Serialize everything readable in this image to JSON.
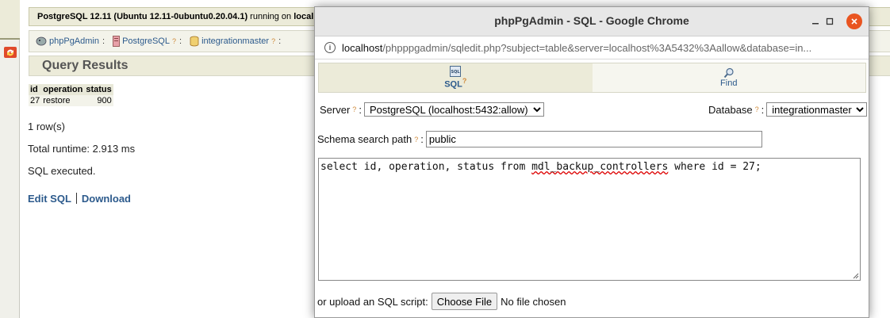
{
  "left_frame": {
    "refresh_icon": "refresh-icon"
  },
  "background": {
    "server_info": {
      "product": "PostgreSQL 12.11 (Ubuntu 12.11-0ubuntu0.20.04.1)",
      "running_on": "running on",
      "host": "local"
    },
    "trail": [
      {
        "label": "phpPgAdmin",
        "icon": "elephant-icon"
      },
      {
        "label": "PostgreSQL",
        "icon": "server-icon"
      },
      {
        "label": "integrationmaster",
        "icon": "database-icon"
      }
    ],
    "help_mark": "?",
    "results_title": "Query Results",
    "table": {
      "columns": [
        "id",
        "operation",
        "status"
      ],
      "rows": [
        {
          "id": "27",
          "operation": "restore",
          "status": "900"
        }
      ]
    },
    "row_count": "1 row(s)",
    "runtime": "Total runtime: 2.913 ms",
    "executed": "SQL executed.",
    "links": {
      "edit": "Edit SQL",
      "download": "Download"
    }
  },
  "popup": {
    "window_title": "phpPgAdmin - SQL - Google Chrome",
    "url_host": "localhost",
    "url_path": "/phpppgadmin/sqledit.php?subject=table&server=localhost%3A5432%3Aallow&database=in...",
    "tabs": [
      {
        "label": "SQL",
        "icon": "sql-icon",
        "active": true
      },
      {
        "label": "Find",
        "icon": "search-icon",
        "active": false
      }
    ],
    "server_label": "Server",
    "server_value": "PostgreSQL (localhost:5432:allow)",
    "database_label": "Database",
    "database_value": "integrationmaster",
    "schema_label": "Schema search path",
    "schema_value": "public",
    "sql_before": "select id, operation, status from ",
    "sql_table": "mdl_backup_controllers",
    "sql_after": " where id = 27;",
    "upload_label": "or upload an SQL script:",
    "choose_file": "Choose File",
    "no_file": "No file chosen",
    "help_mark": "?"
  }
}
